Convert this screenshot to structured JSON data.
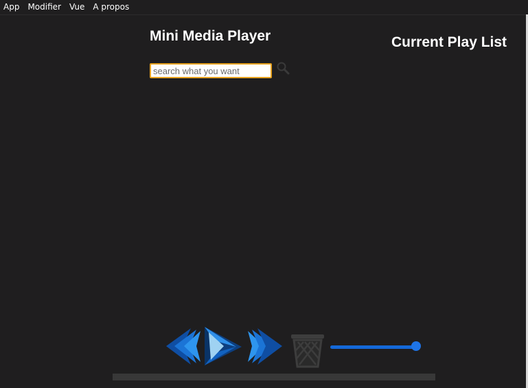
{
  "menu": {
    "items": [
      "App",
      "Modifier",
      "Vue",
      "A propos"
    ]
  },
  "header": {
    "title": "Mini Media Player",
    "playlist_title": "Current Play List"
  },
  "search": {
    "placeholder": "search what you want",
    "value": "",
    "icon": "search-icon"
  },
  "controls": {
    "prev_icon": "previous-icon",
    "play_icon": "play-icon",
    "next_icon": "next-icon",
    "trash_icon": "trash-icon",
    "accent_color": "#1e74e6"
  },
  "volume": {
    "level": 1.0
  },
  "progress": {
    "level": 0.0
  }
}
